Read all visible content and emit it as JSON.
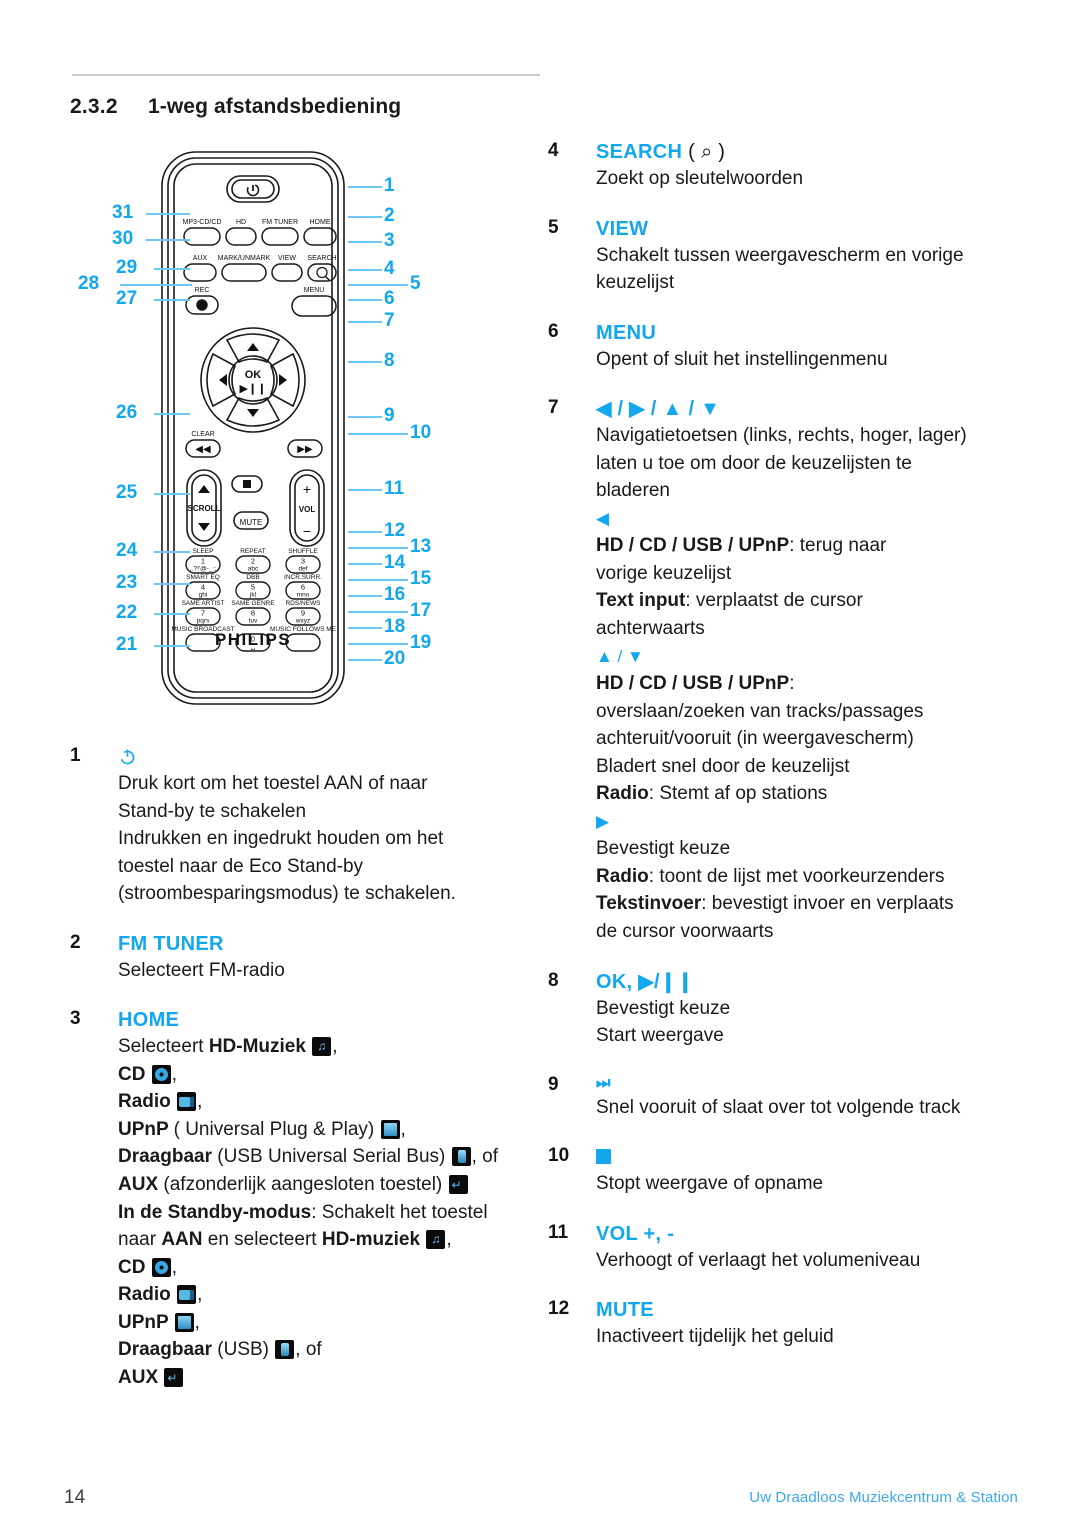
{
  "header": {
    "section_number": "2.3.2",
    "section_title": "1-weg afstandsbediening"
  },
  "figure": {
    "brand": "PHILIPS",
    "button_labels": {
      "row1": [
        "MP3-CD/CD",
        "HD",
        "FM TUNER",
        "HOME"
      ],
      "row2": [
        "AUX",
        "MARK/UNMARK",
        "VIEW",
        "SEARCH"
      ],
      "row3": [
        "REC",
        "MENU"
      ],
      "ok": "OK",
      "clear": "CLEAR",
      "scroll": "SCROLL",
      "vol": "VOL",
      "mute": "MUTE",
      "keypad": [
        {
          "top": "SLEEP",
          "num": "1",
          "sub": ",.?!'@-_:;"
        },
        {
          "top": "REPEAT",
          "num": "2",
          "sub": "abc"
        },
        {
          "top": "SHUFFLE",
          "num": "3",
          "sub": "def"
        },
        {
          "top": "SMART EQ",
          "num": "4",
          "sub": "ghi"
        },
        {
          "top": "DBB",
          "num": "5",
          "sub": "jkl"
        },
        {
          "top": "INCR.SURR.",
          "num": "6",
          "sub": "mno"
        },
        {
          "top": "SAME ARTIST",
          "num": "7",
          "sub": "pqrs"
        },
        {
          "top": "SAME GENRE",
          "num": "8",
          "sub": "tuv"
        },
        {
          "top": "RDS/NEWS",
          "num": "9",
          "sub": "wxyz"
        },
        {
          "top": "MUSIC BROADCAST",
          "num": "",
          "sub": ""
        },
        {
          "top": "",
          "num": "0",
          "sub": "␣"
        },
        {
          "top": "MUSIC FOLLOWS ME",
          "num": "",
          "sub": ""
        }
      ]
    },
    "callouts_left": [
      "31",
      "30",
      "29",
      "28",
      "27",
      "26",
      "25",
      "24",
      "23",
      "22",
      "21"
    ],
    "callouts_right": [
      "1",
      "2",
      "3",
      "4",
      "5",
      "6",
      "7",
      "8",
      "9",
      "10",
      "11",
      "12",
      "13",
      "14",
      "15",
      "16",
      "17",
      "18",
      "19",
      "20"
    ]
  },
  "left_column": [
    {
      "num": "1",
      "head_icon": "power-icon",
      "head": "",
      "lines": [
        "Druk kort om het toestel AAN of naar",
        "Stand-by te schakelen",
        "Indrukken en ingedrukt houden om het",
        "toestel naar de Eco Stand-by",
        "(stroombesparingsmodus) te schakelen."
      ]
    },
    {
      "num": "2",
      "head": "FM TUNER",
      "lines": [
        "Selecteert FM-radio"
      ]
    },
    {
      "num": "3",
      "head": "HOME",
      "rich": [
        [
          {
            "t": "Selecteert "
          },
          {
            "t": "HD-Muziek ",
            "b": true
          },
          {
            "icon": "note"
          },
          {
            "t": ","
          }
        ],
        [
          {
            "t": "CD ",
            "b": true
          },
          {
            "icon": "cd"
          },
          {
            "t": ","
          }
        ],
        [
          {
            "t": "Radio ",
            "b": true
          },
          {
            "icon": "radio"
          },
          {
            "t": ","
          }
        ],
        [
          {
            "t": "UPnP ",
            "b": true
          },
          {
            "t": "( Universal Plug & Play) "
          },
          {
            "icon": "upnp"
          },
          {
            "t": ","
          }
        ],
        [
          {
            "t": "Draagbaar ",
            "b": true
          },
          {
            "t": "(USB Universal Serial Bus) "
          },
          {
            "icon": "usb"
          },
          {
            "t": ", of"
          }
        ],
        [
          {
            "t": "AUX ",
            "b": true
          },
          {
            "t": "(afzonderlijk aangesloten toestel) "
          },
          {
            "icon": "aux"
          }
        ],
        [
          {
            "t": "In de Standby-modus",
            "b": true
          },
          {
            "t": ": Schakelt het toestel"
          }
        ],
        [
          {
            "t": "naar "
          },
          {
            "t": "AAN ",
            "b": true
          },
          {
            "t": "en selecteert "
          },
          {
            "t": "HD-muziek ",
            "b": true
          },
          {
            "icon": "note"
          },
          {
            "t": ","
          }
        ],
        [
          {
            "t": "CD ",
            "b": true
          },
          {
            "icon": "cd"
          },
          {
            "t": ","
          }
        ],
        [
          {
            "t": "Radio ",
            "b": true
          },
          {
            "icon": "radio"
          },
          {
            "t": ","
          }
        ],
        [
          {
            "t": "UPnP ",
            "b": true
          },
          {
            "icon": "upnp"
          },
          {
            "t": ","
          }
        ],
        [
          {
            "t": "Draagbaar ",
            "b": true
          },
          {
            "t": "(USB) "
          },
          {
            "icon": "usb"
          },
          {
            "t": ", of"
          }
        ],
        [
          {
            "t": "AUX ",
            "b": true
          },
          {
            "icon": "aux"
          }
        ]
      ]
    }
  ],
  "right_column": [
    {
      "num": "4",
      "head": "SEARCH",
      "head_suffix": "( ⌕ )",
      "lines": [
        "Zoekt op sleutelwoorden"
      ]
    },
    {
      "num": "5",
      "head": "VIEW",
      "lines": [
        "Schakelt tussen weergavescherm en vorige",
        "keuzelijst"
      ]
    },
    {
      "num": "6",
      "head": "MENU",
      "lines": [
        "Opent of sluit het instellingenmenu"
      ]
    },
    {
      "num": "7",
      "head_arrows": "◀ / ▶ / ▲ / ▼",
      "rich": [
        [
          {
            "t": "Navigatietoetsen (links, rechts, hoger, lager)"
          }
        ],
        [
          {
            "t": "laten u toe om door de keuzelijsten te"
          }
        ],
        [
          {
            "t": "bladeren"
          }
        ],
        [
          {
            "arrow": "◀"
          }
        ],
        [
          {
            "t": "HD / CD / USB / UPnP",
            "b": true
          },
          {
            "t": ": terug naar"
          }
        ],
        [
          {
            "t": "vorige keuzelijst"
          }
        ],
        [
          {
            "t": "Text input",
            "b": true
          },
          {
            "t": ": verplaatst de cursor"
          }
        ],
        [
          {
            "t": "achterwaarts"
          }
        ],
        [
          {
            "arrow": "▲ / ▼"
          }
        ],
        [
          {
            "t": "HD / CD / USB / UPnP",
            "b": true
          },
          {
            "t": ":"
          }
        ],
        [
          {
            "t": "overslaan/zoeken van tracks/passages"
          }
        ],
        [
          {
            "t": "achteruit/vooruit (in weergavescherm)"
          }
        ],
        [
          {
            "t": "Bladert snel door de keuzelijst"
          }
        ],
        [
          {
            "t": "Radio",
            "b": true
          },
          {
            "t": ": Stemt af op stations"
          }
        ],
        [
          {
            "arrow": "▶"
          }
        ],
        [
          {
            "t": "Bevestigt keuze"
          }
        ],
        [
          {
            "t": "Radio",
            "b": true
          },
          {
            "t": ": toont de lijst met voorkeurzenders"
          }
        ],
        [
          {
            "t": "Tekstinvoer",
            "b": true
          },
          {
            "t": ": bevestigt invoer en verplaats"
          }
        ],
        [
          {
            "t": "de cursor voorwaarts"
          }
        ]
      ]
    },
    {
      "num": "8",
      "head": "OK, ▶/❙❙",
      "lines": [
        "Bevestigt keuze",
        "Start weergave"
      ]
    },
    {
      "num": "9",
      "head_glyph": "⏭",
      "lines": [
        "Snel vooruit of slaat over tot volgende track"
      ]
    },
    {
      "num": "10",
      "head_square": true,
      "lines": [
        "Stopt weergave of opname"
      ]
    },
    {
      "num": "11",
      "head": "VOL +, -",
      "lines": [
        "Verhoogt of verlaagt het volumeniveau"
      ]
    },
    {
      "num": "12",
      "head": "MUTE",
      "lines": [
        "Inactiveert tijdelijk het geluid"
      ]
    }
  ],
  "footer": {
    "page_number": "14",
    "note": "Uw Draadloos Muziekcentrum & Station"
  },
  "colors": {
    "accent_blue": "#12A7EE",
    "lead_line": "#6ec6f2",
    "text": "#1a1a1a"
  }
}
